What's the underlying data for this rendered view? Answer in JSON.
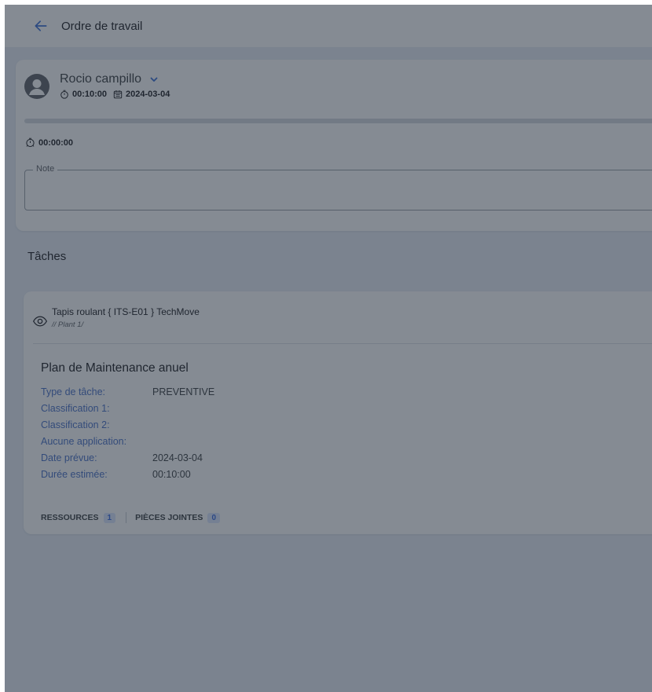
{
  "header": {
    "title": "Ordre de travail",
    "back_icon": "arrow-left-icon"
  },
  "assignment": {
    "user_name": "Rocio campillo",
    "duration": "00:10:00",
    "date": "2024-03-04",
    "elapsed": "00:00:00",
    "progress_fraction": 0,
    "note_label": "Note",
    "note_value": ""
  },
  "tasks_section": {
    "title": "Tâches"
  },
  "task": {
    "asset_name": "Tapis roulant { ITS-E01 } TechMove",
    "asset_path": "// Plant 1/",
    "plan_title": "Plan de Maintenance anuel",
    "details": [
      {
        "label": "Type de tâche:",
        "value": "PREVENTIVE"
      },
      {
        "label": "Classification 1:",
        "value": ""
      },
      {
        "label": "Classification 2:",
        "value": ""
      },
      {
        "label": "Aucune application:",
        "value": ""
      },
      {
        "label": "Date prévue:",
        "value": "2024-03-04"
      },
      {
        "label": "Durée estimée:",
        "value": "00:10:00"
      }
    ],
    "tabs": [
      {
        "label": "RESSOURCES",
        "count": "1"
      },
      {
        "label": "PIÈCES JOINTES",
        "count": "0"
      }
    ]
  },
  "colors": {
    "accent": "#4a72c8",
    "background": "#e9eef7",
    "overlay": "rgba(33,43,58,0.55)"
  }
}
